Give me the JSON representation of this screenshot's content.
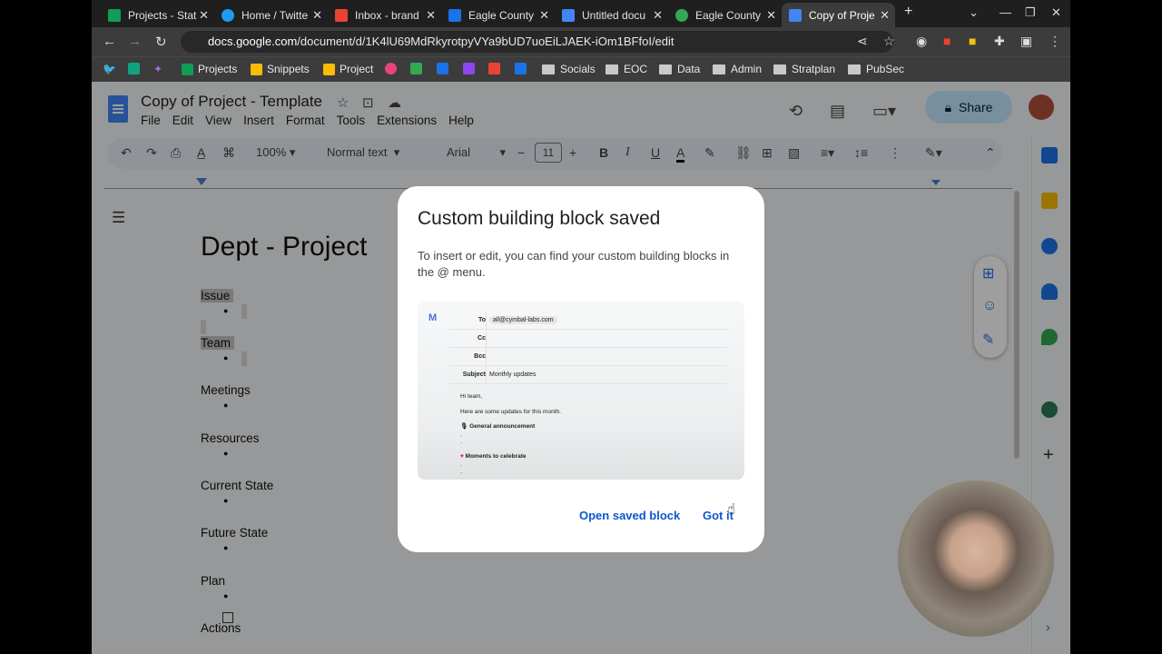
{
  "browser": {
    "tabs": [
      {
        "title": "Projects - Stat",
        "color": "#0f9d58"
      },
      {
        "title": "Home / Twitte",
        "color": "#1d9bf0"
      },
      {
        "title": "Inbox - brand",
        "color": "#ea4335"
      },
      {
        "title": "Eagle County",
        "color": "#1a73e8"
      },
      {
        "title": "Untitled docu",
        "color": "#4285f4"
      },
      {
        "title": "Eagle County",
        "color": "#34a853"
      },
      {
        "title": "Copy of Proje",
        "color": "#4285f4"
      }
    ],
    "tab_close": "✕",
    "new_tab": "+",
    "url_domain": "docs.google.com",
    "url_path": "/document/d/1K4lU69MdRkyrotpyVYa9bUD7uoEiLJAEK-iOm1BFfoI/edit",
    "bookmarks": [
      "Projects",
      "Snippets",
      "Project",
      "Socials",
      "EOC",
      "Data",
      "Admin",
      "Stratplan",
      "PubSec"
    ]
  },
  "docs": {
    "title": "Copy of Project - Template",
    "menu": [
      "File",
      "Edit",
      "View",
      "Insert",
      "Format",
      "Tools",
      "Extensions",
      "Help"
    ],
    "share_label": "Share",
    "toolbar": {
      "zoom": "100%",
      "style": "Normal text",
      "font": "Arial",
      "font_size": "11"
    },
    "document": {
      "heading": "Dept - Project",
      "sections": [
        "Issue",
        "Team",
        "Meetings",
        "Resources",
        "Current State",
        "Future State",
        "Plan",
        "Actions"
      ]
    }
  },
  "dialog": {
    "title": "Custom building block saved",
    "body": "To insert or edit, you can find your custom building blocks in the @ menu.",
    "preview": {
      "fields": [
        {
          "label": "To",
          "value": "all@cymbal-labs.com"
        },
        {
          "label": "Cc",
          "value": ""
        },
        {
          "label": "Bcc",
          "value": ""
        },
        {
          "label": "Subject",
          "value": "Monthly updates"
        }
      ],
      "greeting": "Hi team,",
      "intro": "Here are some updates for this month.",
      "section1": "General announcement",
      "section2": "Moments to celebrate"
    },
    "open_button": "Open saved block",
    "got_it_button": "Got it"
  },
  "icons": [
    "back-icon",
    "forward-icon",
    "reload-icon",
    "star-icon",
    "history-icon",
    "comment-icon",
    "lock-icon",
    "checklist-icon"
  ]
}
